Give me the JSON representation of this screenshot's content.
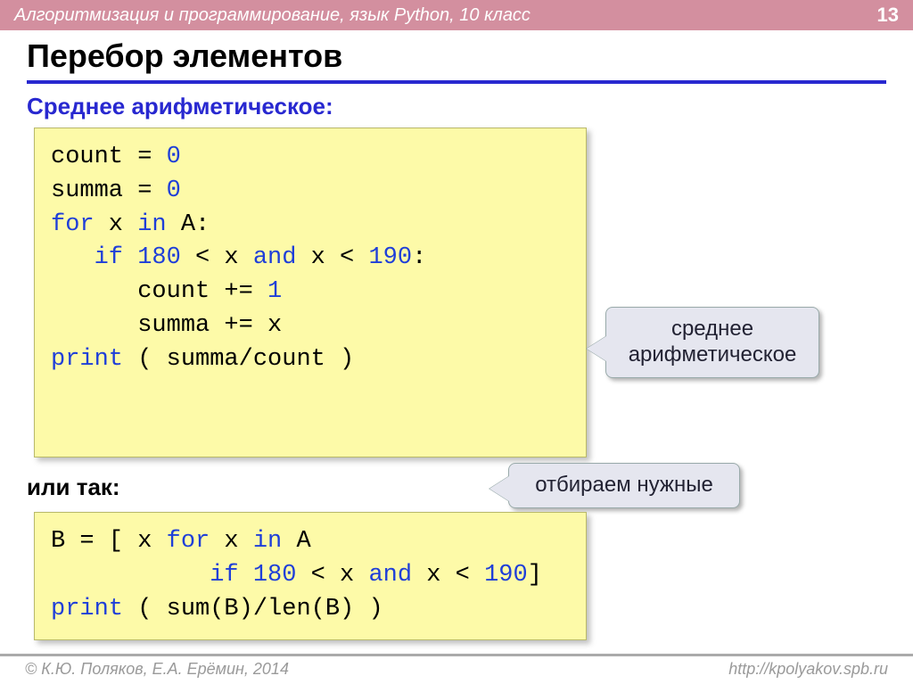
{
  "header": {
    "course": "Алгоритмизация и программирование, язык Python, 10 класс",
    "page": "13"
  },
  "title": "Перебор элементов",
  "sections": {
    "avg_heading": "Среднее арифметическое:",
    "code1": {
      "l1a": "count",
      "l1b": " = ",
      "l1c": "0",
      "l2a": "summa",
      "l2b": " = ",
      "l2c": "0",
      "l3a": "for",
      "l3b": " x ",
      "l3c": "in",
      "l3d": " A:",
      "l4a": "   ",
      "l4b": "if",
      "l4c": " ",
      "l4d": "180",
      "l4e": " < x ",
      "l4f": "and",
      "l4g": " x < ",
      "l4h": "190",
      "l4i": ":",
      "l5a": "      count += ",
      "l5b": "1",
      "l6a": "      summa += x",
      "l7a": "print",
      "l7b": " ( summa/count )"
    },
    "callout1": "среднее арифметическое",
    "or_heading": "или так:",
    "callout2": "отбираем нужные",
    "code2": {
      "l1a": "B = [ x ",
      "l1b": "for",
      "l1c": " x ",
      "l1d": "in",
      "l1e": " A",
      "l2a": "           ",
      "l2b": "if",
      "l2c": " ",
      "l2d": "180",
      "l2e": " < x ",
      "l2f": "and",
      "l2g": " x < ",
      "l2h": "190",
      "l2i": "]",
      "l3a": "print",
      "l3b": " ( sum(B)/len(B) )"
    }
  },
  "footer": {
    "left": "© К.Ю. Поляков, Е.А. Ерёмин, 2014",
    "right": "http://kpolyakov.spb.ru"
  }
}
